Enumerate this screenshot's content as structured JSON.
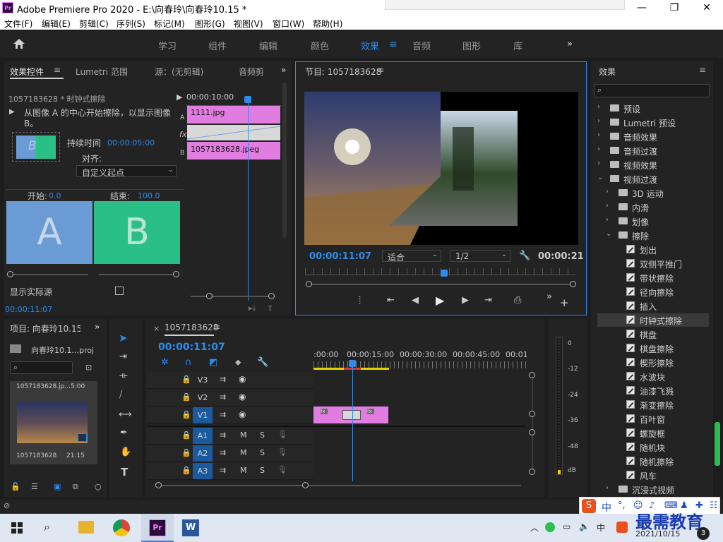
{
  "window": {
    "title": "Adobe Premiere Pro 2020 - E:\\向春玲\\向春玲10.15 *",
    "minimize": "—",
    "maximize": "❐",
    "close": "✕"
  },
  "menu": [
    "文件(F)",
    "编辑(E)",
    "剪辑(C)",
    "序列(S)",
    "标记(M)",
    "图形(G)",
    "视图(V)",
    "窗口(W)",
    "帮助(H)"
  ],
  "workspaces": [
    "学习",
    "组件",
    "编辑",
    "颜色",
    "效果",
    "音频",
    "图形",
    "库"
  ],
  "effect_controls": {
    "tabs": [
      "效果控件",
      "Lumetri 范围",
      "源：(无剪辑)",
      "音频剪"
    ],
    "clip": "1057183628 * 时钟式擦除",
    "timecode_ruler": "00:00:10:00",
    "description": "从图像 A 的中心开始擦除，以显示图像 B。",
    "duration_label": "持续时间",
    "duration_value": "00:00:05:00",
    "align_label": "对齐:",
    "align_value": "自定义起点",
    "start_label": "开始:",
    "start_value": "0.0",
    "end_label": "结束:",
    "end_value": "100.0",
    "a_letter": "A",
    "b_letter": "B",
    "show_actual": "显示实际源",
    "clip_a": "1111.jpg",
    "clip_b": "1057183628.jpeg",
    "track_a": "A",
    "track_b": "B",
    "fx": "fx",
    "current_time": "00:00:11:07"
  },
  "program": {
    "title": "节目: 1057183628",
    "timecode": "00:00:11:07",
    "fit": "适合",
    "quality": "1/2",
    "duration": "00:00:21"
  },
  "effects_panel": {
    "title": "效果",
    "items": [
      {
        "label": "预设",
        "level": 0,
        "type": "folder",
        "open": false
      },
      {
        "label": "Lumetri 预设",
        "level": 0,
        "type": "folder",
        "open": false
      },
      {
        "label": "音频效果",
        "level": 0,
        "type": "folder",
        "open": false
      },
      {
        "label": "音频过渡",
        "level": 0,
        "type": "folder",
        "open": false
      },
      {
        "label": "视频效果",
        "level": 0,
        "type": "folder",
        "open": false
      },
      {
        "label": "视频过渡",
        "level": 0,
        "type": "folder",
        "open": true
      },
      {
        "label": "3D 运动",
        "level": 1,
        "type": "folder",
        "open": false
      },
      {
        "label": "内滑",
        "level": 1,
        "type": "folder",
        "open": false
      },
      {
        "label": "划像",
        "level": 1,
        "type": "folder",
        "open": false
      },
      {
        "label": "擦除",
        "level": 1,
        "type": "folder",
        "open": true
      },
      {
        "label": "划出",
        "level": 2,
        "type": "fx"
      },
      {
        "label": "双侧平推门",
        "level": 2,
        "type": "fx"
      },
      {
        "label": "带状擦除",
        "level": 2,
        "type": "fx"
      },
      {
        "label": "径向擦除",
        "level": 2,
        "type": "fx"
      },
      {
        "label": "插入",
        "level": 2,
        "type": "fx"
      },
      {
        "label": "时钟式擦除",
        "level": 2,
        "type": "fx",
        "selected": true
      },
      {
        "label": "棋盘",
        "level": 2,
        "type": "fx"
      },
      {
        "label": "棋盘擦除",
        "level": 2,
        "type": "fx"
      },
      {
        "label": "楔形擦除",
        "level": 2,
        "type": "fx"
      },
      {
        "label": "水波块",
        "level": 2,
        "type": "fx"
      },
      {
        "label": "油漆飞溅",
        "level": 2,
        "type": "fx"
      },
      {
        "label": "渐变擦除",
        "level": 2,
        "type": "fx"
      },
      {
        "label": "百叶窗",
        "level": 2,
        "type": "fx"
      },
      {
        "label": "螺旋框",
        "level": 2,
        "type": "fx"
      },
      {
        "label": "随机块",
        "level": 2,
        "type": "fx"
      },
      {
        "label": "随机擦除",
        "level": 2,
        "type": "fx"
      },
      {
        "label": "风车",
        "level": 2,
        "type": "fx"
      },
      {
        "label": "沉浸式视频",
        "level": 1,
        "type": "folder",
        "open": false
      }
    ]
  },
  "project": {
    "title": "项目: 向春玲10.15",
    "file": "向春玲10.1...proj",
    "thumb_name": "1057183628.jp...",
    "thumb_dur": "5:00",
    "item_name": "1057183628",
    "item_dur": "21:15"
  },
  "timeline": {
    "tab": "1057183628",
    "timecode": "00:00:11:07",
    "ruler": [
      ":00:00",
      "00:00:15:00",
      "00:00:30:00",
      "00:00:45:00",
      "00:01:0"
    ],
    "video_tracks": [
      "V3",
      "V2",
      "V1"
    ],
    "audio_tracks": [
      "A1",
      "A2",
      "A3"
    ],
    "m": "M",
    "s": "S"
  },
  "meter": {
    "labels": [
      "0",
      "-12",
      "-24",
      "-36",
      "-48",
      "dB"
    ]
  },
  "taskbar": {
    "date": "2021/10/15",
    "watermark": "最需教育",
    "ime": "中"
  },
  "colors": {
    "accent": "#2d8ceb",
    "clip_pink": "#e17de0",
    "a_blue": "#6b9bd4",
    "b_green": "#2bbf88"
  }
}
